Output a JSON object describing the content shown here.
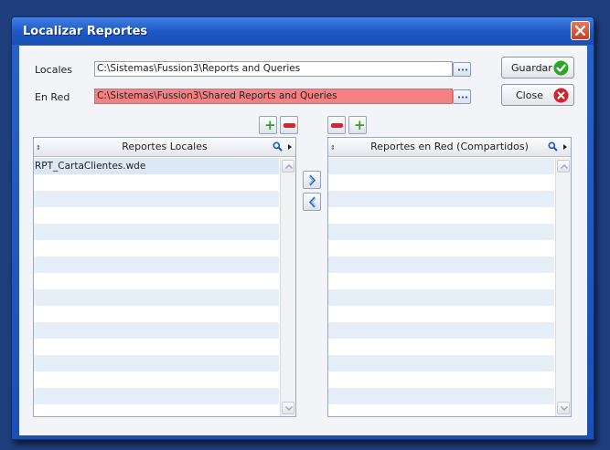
{
  "window": {
    "title": "Localizar Reportes"
  },
  "paths": {
    "local_label": "Locales",
    "local_value": "C:\\Sistemas\\Fussion3\\Reports and Queries",
    "network_label": "En Red",
    "network_value": "C:\\Sistemas\\Fussion3\\Shared Reports and Queries",
    "browse_icon": "ellipsis-icon"
  },
  "buttons": {
    "save_label": "Guardar",
    "save_icon": "check-icon",
    "close_label": "Close",
    "close_icon": "x-circle-icon"
  },
  "local_list": {
    "header": "Reportes Locales",
    "items": [
      "RPT_CartaClientes.wde"
    ]
  },
  "network_list": {
    "header": "Reportes en Red (Compartidos)",
    "items": []
  },
  "colors": {
    "titlebar": "#1d58c4",
    "network_path_bg": "#f48283",
    "plus_green": "#26a81e",
    "minus_red": "#e21f2a",
    "row_alt": "#e6eef8"
  }
}
